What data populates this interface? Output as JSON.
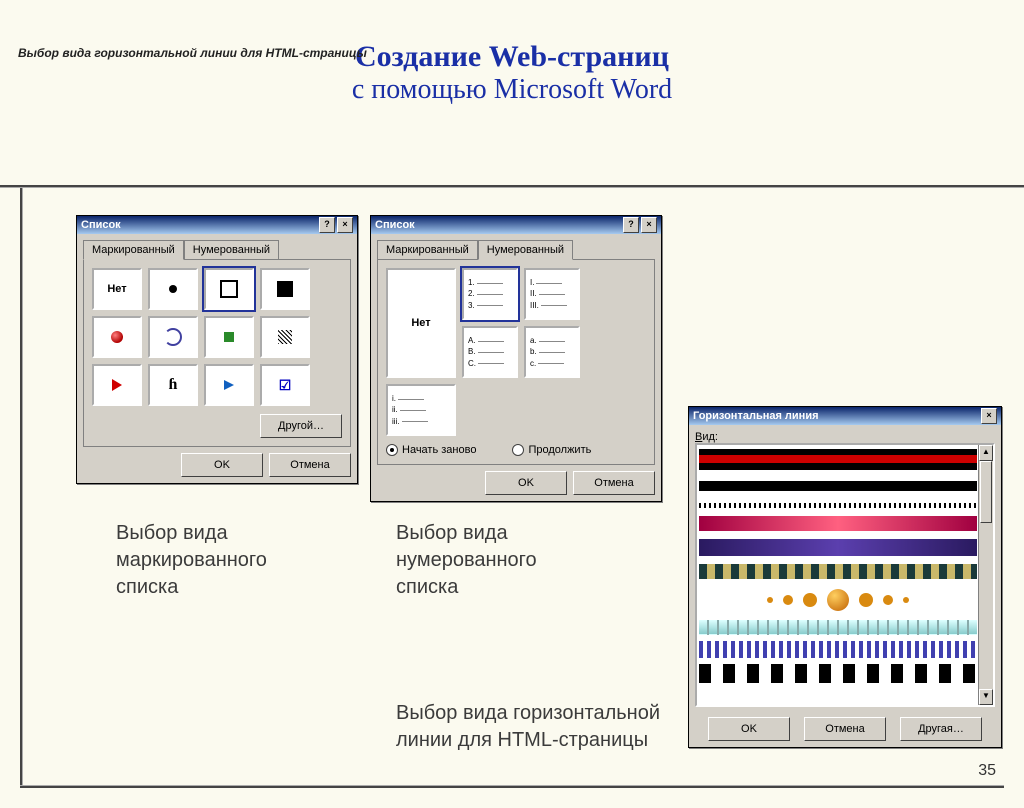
{
  "topnote": "Выбор вида горизонтальной линии для HTML-страницы",
  "heading": {
    "l1": "Создание Web-страниц",
    "l2": "с помощью Microsoft Word"
  },
  "slide_number": "35",
  "dlg_list": {
    "title": "Список",
    "tabs": {
      "bulleted": "Маркированный",
      "numbered": "Нумерованный"
    },
    "none_label": "Нет",
    "other_button": "Другой…",
    "ok": "OK",
    "cancel": "Отмена",
    "radio_restart": "Начать заново",
    "radio_continue": "Продолжить",
    "num_samples": [
      [
        "1.",
        "2.",
        "3."
      ],
      [
        "I.",
        "II.",
        "III."
      ],
      [
        "A.",
        "B.",
        "C."
      ],
      [
        "a.",
        "b.",
        "c."
      ],
      [
        "i.",
        "ii.",
        "iii."
      ]
    ]
  },
  "dlg_hl": {
    "title": "Горизонтальная линия",
    "view_label": "Вид:",
    "ok": "OK",
    "cancel": "Отмена",
    "other": "Другая…"
  },
  "captions": {
    "bulleted": "Выбор вида\nмаркированного\nсписка",
    "numbered": "Выбор вида\nнумерованного\nсписка",
    "hline": "Выбор вида горизонтальной\nлинии для HTML-страницы"
  }
}
